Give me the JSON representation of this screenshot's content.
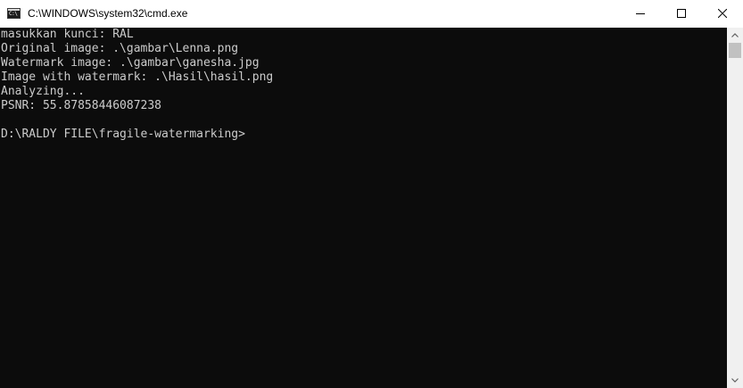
{
  "window": {
    "title": "C:\\WINDOWS\\system32\\cmd.exe",
    "icon": "cmd-icon",
    "icon_text": "C:\\"
  },
  "controls": {
    "minimize_icon": "minimize-icon",
    "maximize_icon": "maximize-icon",
    "close_icon": "close-icon"
  },
  "console": {
    "lines": [
      "masukkan kunci: RAL",
      "Original image: .\\gambar\\Lenna.png",
      "Watermark image: .\\gambar\\ganesha.jpg",
      "Image with watermark: .\\Hasil\\hasil.png",
      "Analyzing...",
      "PSNR: 55.87858446087238",
      "",
      "D:\\RALDY FILE\\fragile-watermarking>"
    ]
  },
  "colors": {
    "console_background": "#0c0c0c",
    "console_text": "#cccccc",
    "titlebar_background": "#ffffff",
    "scrollbar_track": "#f0f0f0",
    "scrollbar_thumb": "#c1c1c1"
  }
}
